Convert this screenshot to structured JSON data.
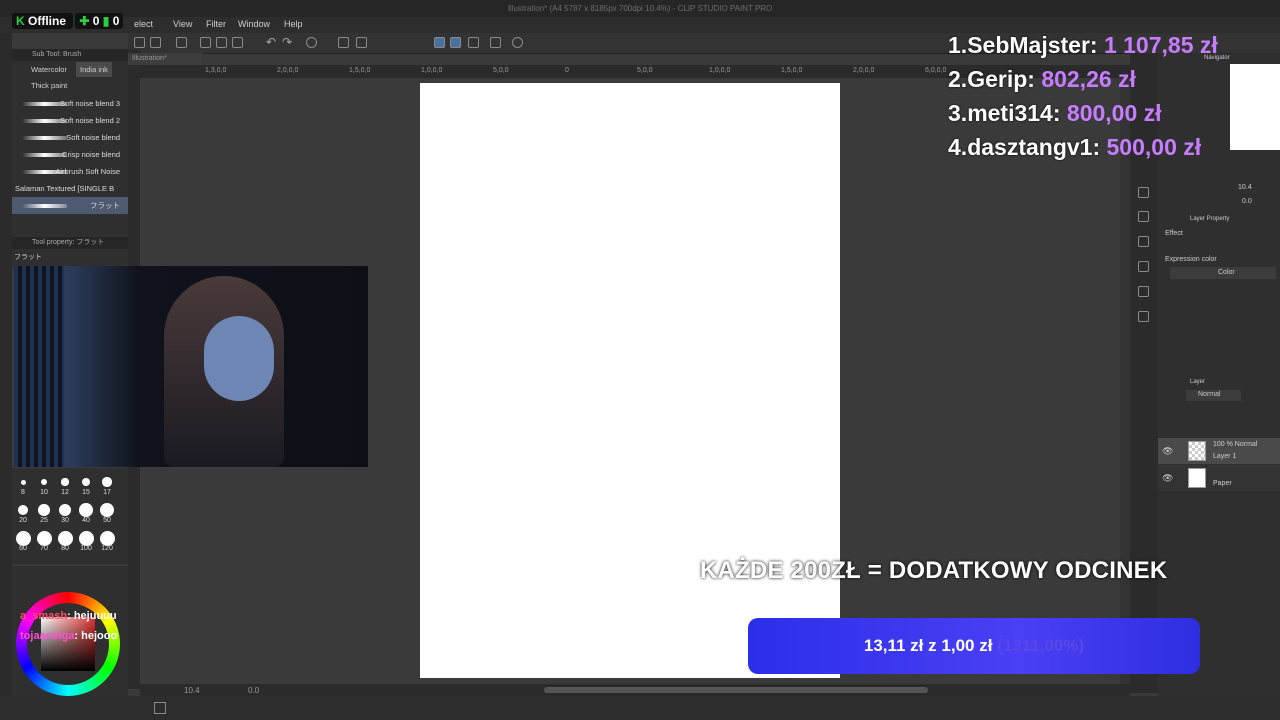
{
  "app": {
    "title": "Illustration* (A4 5787 x 8185px 700dpi 10.4%) - CLIP STUDIO PAINT PRO"
  },
  "menu": {
    "items": [
      "elect",
      "View",
      "Filter",
      "Window",
      "Help"
    ]
  },
  "document": {
    "tab_label": "Illustration*"
  },
  "subtool_panel": {
    "header": "Sub Tool: Brush",
    "groups": [
      "Watercolor",
      "India ink",
      "Thick paint"
    ],
    "brushes": [
      "Soft noise blend 3",
      "Soft noise blend 2",
      "Soft noise blend",
      "Crisp noise blend",
      "Airbrush Soft Noise",
      "Salaman Textured [SINGLE B",
      "フラット"
    ]
  },
  "tool_property": {
    "header": "Tool property: フラット",
    "tab": "フラット"
  },
  "brush_sizes": [
    "8",
    "10",
    "12",
    "15",
    "17",
    "20",
    "25",
    "30",
    "40",
    "50",
    "60",
    "70",
    "80",
    "100",
    "120"
  ],
  "ruler": {
    "labels": [
      "1,3,0,0",
      "2,0,0,0",
      "1,5,0,0",
      "1,0,0,0",
      "5,0,0",
      "0",
      "5,0,0",
      "1,0,0,0",
      "1,5,0,0",
      "2,0,0,0",
      "6,0,0,0"
    ]
  },
  "status_bar": {
    "zoom": "10.4",
    "angle": "0.0"
  },
  "stream_status": {
    "offline_label": "Offline",
    "count_a": "0",
    "count_b": "0"
  },
  "leaderboard": [
    {
      "rank": "1.",
      "name": "SebMajster:",
      "amount": "1 107,85 zł"
    },
    {
      "rank": "2.",
      "name": "Gerip:",
      "amount": "802,26 zł"
    },
    {
      "rank": "3.",
      "name": "meti314:",
      "amount": "800,00 zł"
    },
    {
      "rank": "4.",
      "name": "dasztangv1:",
      "amount": "500,00 zł"
    }
  ],
  "goal": {
    "headline": "KAŻDE 200ZŁ = DODATKOWY ODCINEK",
    "current": "13,11 zł",
    "separator": "z",
    "target": "1,00 zł",
    "percent_text": "(1311,00%)",
    "fraction": 13.11
  },
  "chat": [
    {
      "user": "a_smash",
      "message": "hejuuuu",
      "user_color": "#ff4d6d"
    },
    {
      "user": "tojaanelga",
      "message": "hejooo",
      "user_color": "#ff4fd8"
    }
  ],
  "right_panel": {
    "navigator_label": "Navigator",
    "navigator_zoom": "10.4",
    "navigator_angle": "0.0",
    "layer_property_label": "Layer Property",
    "effect_label": "Effect",
    "expression_color_label": "Expression color",
    "expression_color_value": "Color",
    "layer_panel_label": "Layer",
    "blend_mode": "Normal",
    "layers": [
      {
        "top": "100 % Normal",
        "name": "Layer 1"
      },
      {
        "top": "",
        "name": "Paper"
      }
    ]
  },
  "colors": {
    "accent_purple": "#c77dff",
    "goal_blue": "#3a36ec",
    "offline_green": "#2ecc40"
  }
}
